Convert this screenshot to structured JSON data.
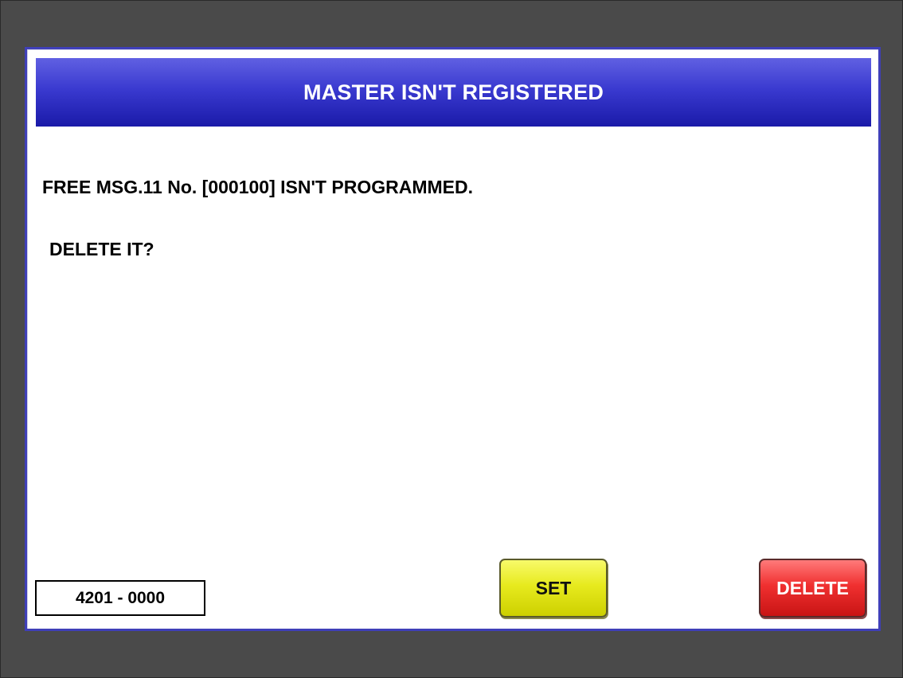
{
  "dialog": {
    "title": "MASTER ISN'T REGISTERED",
    "message_line1": "FREE MSG.11 No. [000100] ISN'T PROGRAMMED.",
    "message_line2": "DELETE IT?"
  },
  "status": {
    "code": "4201 - 0000"
  },
  "buttons": {
    "set_label": "SET",
    "delete_label": "DELETE"
  },
  "colors": {
    "background": "#4a4a4a",
    "title_bar": "#3a3ad0",
    "set_button": "#e7ea1e",
    "delete_button": "#f03030"
  }
}
